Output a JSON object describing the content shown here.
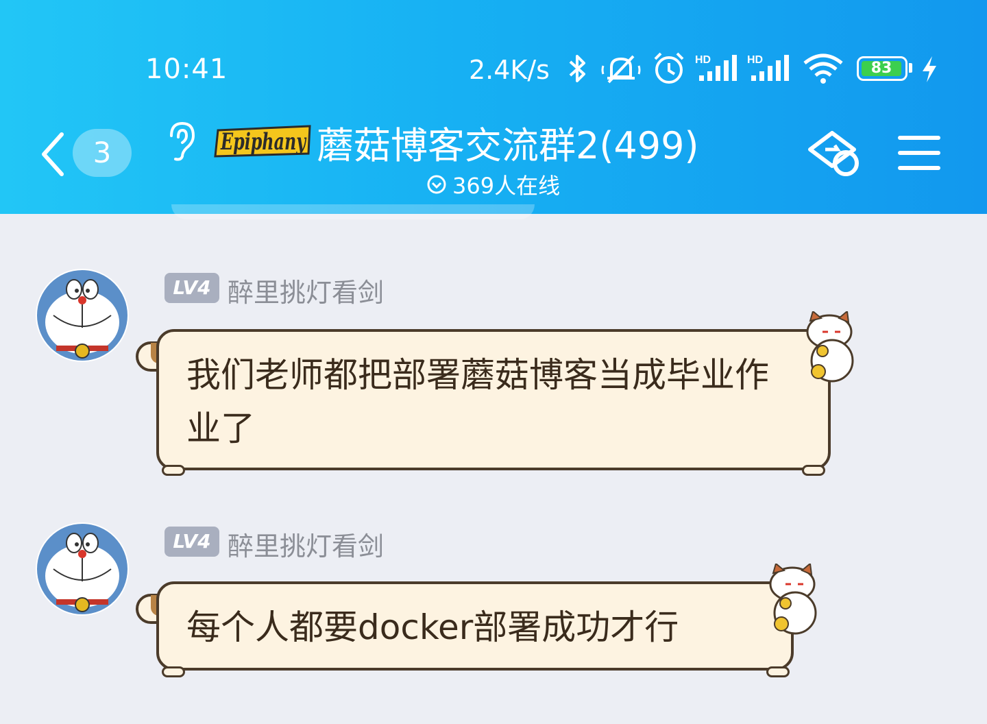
{
  "status_bar": {
    "time": "10:41",
    "net_speed": "2.4K/s",
    "hd_label_1": "HD",
    "hd_label_2": "HD",
    "battery_level": "83"
  },
  "header": {
    "unread_count": "3",
    "group_logo_text": "Epiphany",
    "group_name": "蘑菇博客交流群2(499)",
    "online_text": "369人在线"
  },
  "messages": [
    {
      "level": "LV4",
      "sender": "醉里挑灯看剑",
      "text": "我们老师都把部署蘑菇博客当成毕业作业了"
    },
    {
      "level": "LV4",
      "sender": "醉里挑灯看剑",
      "text": "每个人都要docker部署成功才行"
    }
  ],
  "colors": {
    "header_gradient_start": "#22c6f6",
    "header_gradient_end": "#1298ee",
    "chat_background": "#eceef4",
    "bubble_fill": "#fdf3e1",
    "bubble_border": "#4b3b2a",
    "level_badge": "#a9afbf",
    "sender_name": "#8b8e96"
  }
}
